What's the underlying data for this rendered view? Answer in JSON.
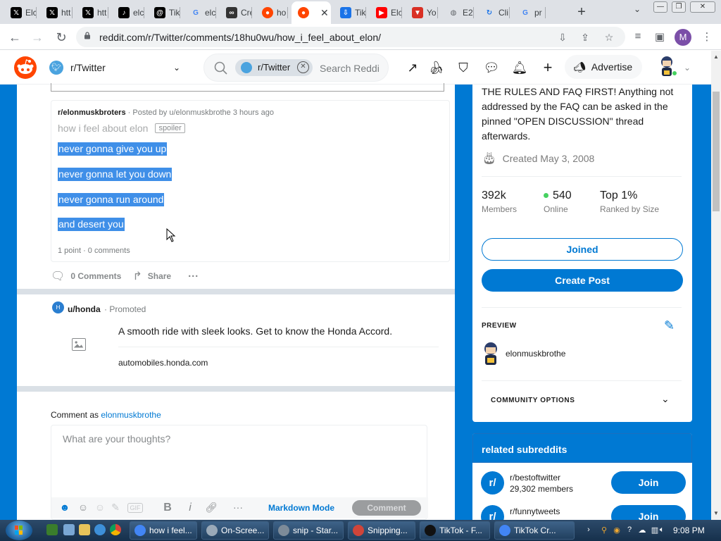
{
  "browser": {
    "tabs": [
      {
        "label": "Elc",
        "icon": "x-icon",
        "color": "#000000"
      },
      {
        "label": "htt",
        "icon": "x-icon",
        "color": "#000000"
      },
      {
        "label": "htt",
        "icon": "x-icon",
        "color": "#000000"
      },
      {
        "label": "elc",
        "icon": "tiktok-icon",
        "color": "#000000"
      },
      {
        "label": "Tik",
        "icon": "threads-icon",
        "color": "#000000"
      },
      {
        "label": "elc",
        "icon": "google-icon",
        "color": "#4285f4"
      },
      {
        "label": "Cre",
        "icon": "meta-icon",
        "color": "#333333"
      },
      {
        "label": "ho",
        "icon": "reddit-icon",
        "color": "#ff4500"
      },
      {
        "label": "",
        "icon": "reddit-icon",
        "color": "#ff4500",
        "active": true
      },
      {
        "label": "Tik",
        "icon": "download-icon",
        "color": "#1a73e8"
      },
      {
        "label": "Elc",
        "icon": "youtube-icon",
        "color": "#ff0000"
      },
      {
        "label": "Yo",
        "icon": "save-icon",
        "color": "#d93025"
      },
      {
        "label": "E2",
        "icon": "globe-icon",
        "color": "#5f6368"
      },
      {
        "label": "Cli",
        "icon": "refresh-icon",
        "color": "#1a73e8"
      },
      {
        "label": "pr",
        "icon": "google-icon",
        "color": "#4285f4"
      }
    ],
    "url": "reddit.com/r/Twitter/comments/18hu0wu/how_i_feel_about_elon/",
    "profile_initial": "M"
  },
  "reddit_header": {
    "subreddit": "r/Twitter",
    "search_chip": "r/Twitter",
    "search_placeholder": "Search Reddit",
    "advertise": "Advertise"
  },
  "embedded_post": {
    "subreddit": "r/elonmuskbroters",
    "posted_by": "· Posted by u/elonmuskbrothe 3 hours ago",
    "title": "how i feel about elon",
    "spoiler": "spoiler",
    "lines": [
      "never gonna give you up",
      "never gonna let you down",
      "never gonna run around",
      "and desert you"
    ],
    "stats": "1 point · 0 comments"
  },
  "post_actions": {
    "comments": "0 Comments",
    "share": "Share",
    "more": "···"
  },
  "ad": {
    "user": "u/honda",
    "promoted": "· Promoted",
    "headline": "A smooth ride with sleek looks. Get to know the Honda Accord.",
    "domain": "automobiles.honda.com"
  },
  "comment_box": {
    "comment_as": "Comment as",
    "username": "elonmuskbrothe",
    "placeholder": "What are your thoughts?",
    "markdown_mode": "Markdown Mode",
    "submit": "Comment"
  },
  "sidebar": {
    "description": "THE RULES AND FAQ FIRST! Anything not addressed by the FAQ can be asked in the pinned \"OPEN DISCUSSION\" thread afterwards.",
    "created": "Created May 3, 2008",
    "stats": [
      {
        "num": "392k",
        "label": "Members"
      },
      {
        "num": "540",
        "label": "Online"
      },
      {
        "num": "Top 1%",
        "label": "Ranked by Size"
      }
    ],
    "joined": "Joined",
    "create_post": "Create Post",
    "preview_label": "PREVIEW",
    "preview_user": "elonmuskbrothe",
    "community_options": "COMMUNITY OPTIONS"
  },
  "related": {
    "title": "related subreddits",
    "items": [
      {
        "name": "r/bestoftwitter",
        "members": "29,302 members",
        "join": "Join"
      },
      {
        "name": "r/funnytweets",
        "members": "",
        "join": "Join"
      }
    ]
  },
  "taskbar": {
    "buttons": [
      {
        "label": "how i feel...",
        "color": "#4285f4"
      },
      {
        "label": "On-Scree...",
        "color": "#9aa9b8"
      },
      {
        "label": "snip - Star...",
        "color": "#7d8b99"
      },
      {
        "label": "Snipping...",
        "color": "#d0453a"
      },
      {
        "label": "TikTok - F...",
        "color": "#111111"
      },
      {
        "label": "TikTok Cr...",
        "color": "#4285f4"
      }
    ],
    "clock": "9:08 PM"
  },
  "colors": {
    "reddit_blue": "#0079d3",
    "reddit_orange": "#ff4500",
    "highlight": "#3f8fe8"
  }
}
